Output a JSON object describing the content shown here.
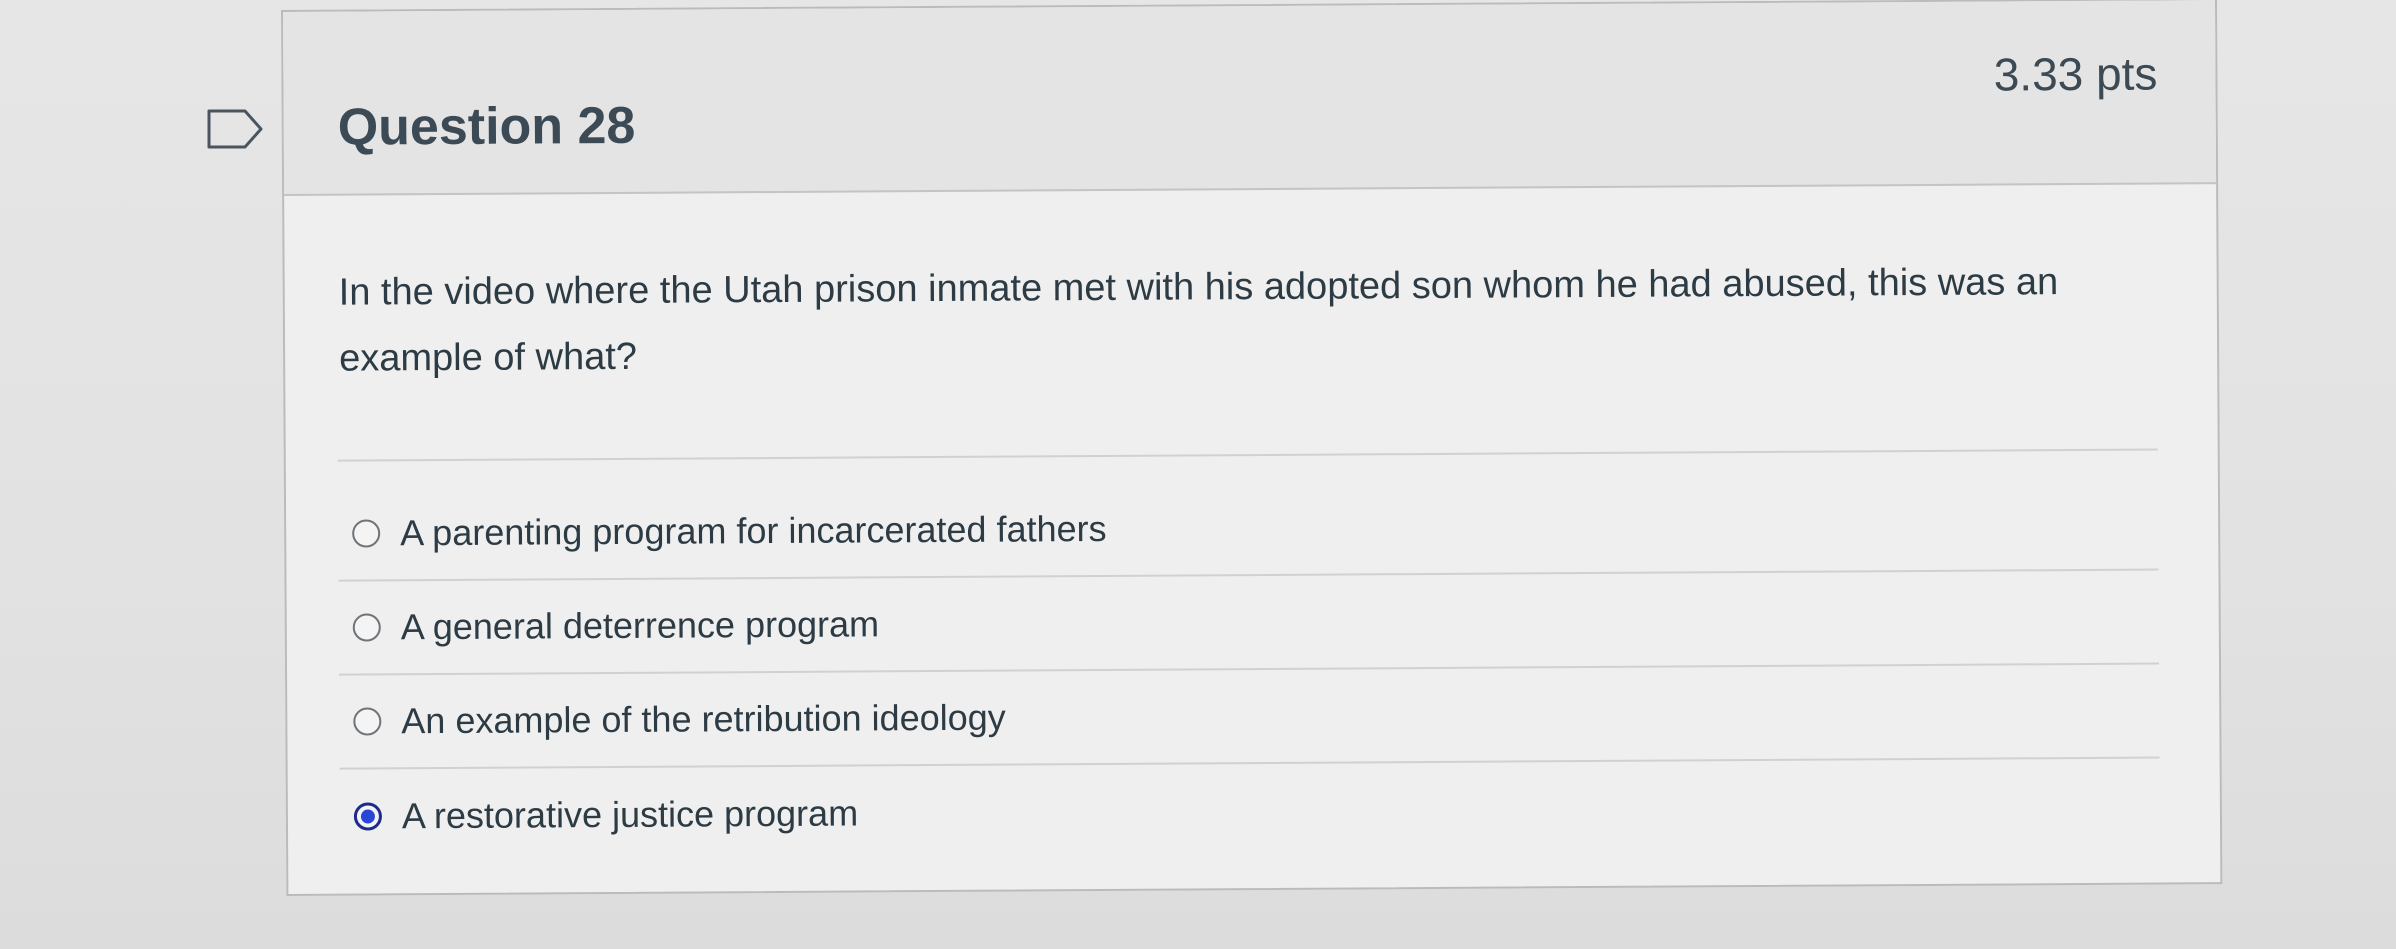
{
  "question": {
    "title": "Question 28",
    "points": "3.33 pts",
    "text": "In the video where the Utah prison inmate met with his adopted son whom he had abused, this was an example of what?",
    "flag_icon": "flag-outline-icon"
  },
  "answers": [
    {
      "label": "A parenting program for incarcerated fathers",
      "selected": false
    },
    {
      "label": "A general deterrence program",
      "selected": false
    },
    {
      "label": "An example of the retribution ideology",
      "selected": false
    },
    {
      "label": "A restorative justice program",
      "selected": true
    }
  ],
  "colors": {
    "radio_selected": "#2a46d6",
    "header_bg": "#e4e4e4",
    "text": "#2d3b45"
  }
}
